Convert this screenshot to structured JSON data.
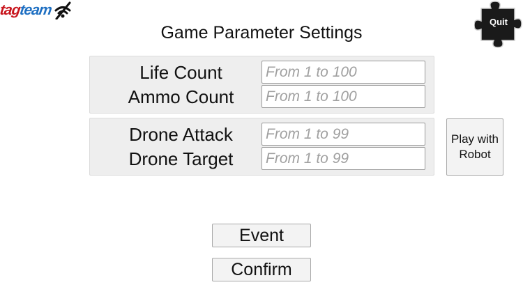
{
  "logo": {
    "part1": "tag",
    "part2": "team",
    "icon": "wifi-icon"
  },
  "title": "Game Parameter Settings",
  "panel1": {
    "life_label": "Life Count",
    "life_placeholder": "From 1 to 100",
    "ammo_label": "Ammo Count",
    "ammo_placeholder": "From 1 to 100"
  },
  "panel2": {
    "attack_label": "Drone Attack",
    "attack_placeholder": "From 1 to 99",
    "target_label": "Drone Target",
    "target_placeholder": "From 1 to 99"
  },
  "buttons": {
    "robot_line1": "Play with",
    "robot_line2": "Robot",
    "event": "Event",
    "confirm": "Confirm",
    "quit": "Quit"
  },
  "colors": {
    "logo_red": "#c8151d",
    "logo_blue": "#1e6fc2",
    "quit_bg": "#1a1a1a"
  }
}
